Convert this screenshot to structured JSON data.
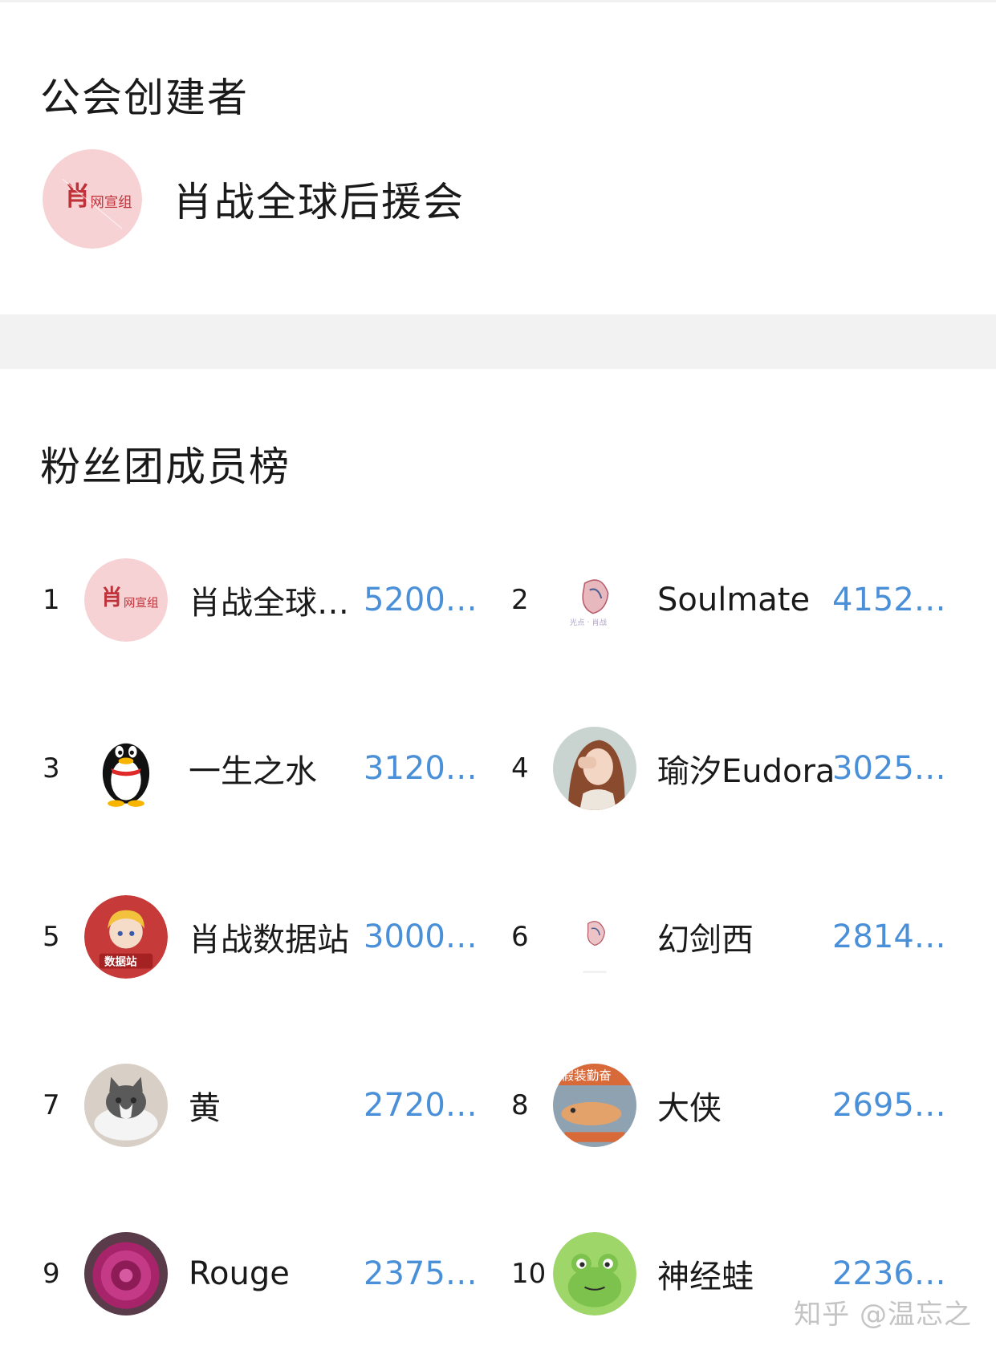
{
  "founder_section": {
    "title": "公会创建者",
    "name": "肖战全球后援会",
    "avatar_icon": "fan-club-logo-icon"
  },
  "ranking_section": {
    "title": "粉丝团成员榜",
    "members": [
      {
        "rank": "1",
        "name": "肖战全球…",
        "score": "5200…",
        "avatar_icon": "fan-club-logo-icon"
      },
      {
        "rank": "2",
        "name": "Soulmate",
        "score": "4152…",
        "avatar_icon": "sketch-portrait-icon"
      },
      {
        "rank": "3",
        "name": "一生之水",
        "score": "3120…",
        "avatar_icon": "qq-penguin-icon"
      },
      {
        "rank": "4",
        "name": "瑜汐Eudora",
        "score": "3025…",
        "avatar_icon": "photo-portrait-icon"
      },
      {
        "rank": "5",
        "name": "肖战数据站",
        "score": "3000…",
        "avatar_icon": "anime-data-station-icon"
      },
      {
        "rank": "6",
        "name": "幻剑西",
        "score": "2814…",
        "avatar_icon": "sketch-portrait-icon"
      },
      {
        "rank": "7",
        "name": "黄",
        "score": "2720…",
        "avatar_icon": "cat-photo-icon"
      },
      {
        "rank": "8",
        "name": "大侠",
        "score": "2695…",
        "avatar_icon": "hamster-photo-icon"
      },
      {
        "rank": "9",
        "name": "Rouge",
        "score": "2375…",
        "avatar_icon": "flower-photo-icon"
      },
      {
        "rank": "10",
        "name": "神经蛙",
        "score": "2236…",
        "avatar_icon": "frog-cartoon-icon"
      }
    ]
  },
  "watermark": "知乎 @温忘之",
  "colors": {
    "score_blue": "#4a90d9",
    "section_band": "#f2f2f2",
    "logo_pink": "#f4c9cc",
    "logo_red": "#c0323a"
  }
}
